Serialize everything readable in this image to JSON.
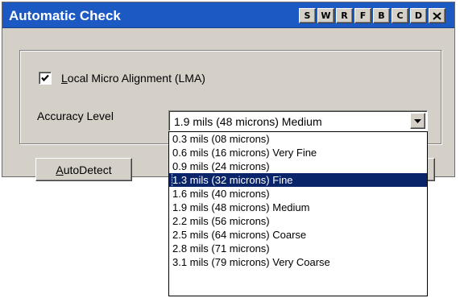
{
  "window": {
    "title": "Automatic Check",
    "title_buttons": [
      {
        "label": "S",
        "name": "title-button-s"
      },
      {
        "label": "W",
        "name": "title-button-w"
      },
      {
        "label": "R",
        "name": "title-button-r"
      },
      {
        "label": "F",
        "name": "title-button-f"
      },
      {
        "label": "B",
        "name": "title-button-b"
      },
      {
        "label": "C",
        "name": "title-button-c"
      },
      {
        "label": "D",
        "name": "title-button-d"
      }
    ],
    "close_icon": "close-icon"
  },
  "lma": {
    "checked": true,
    "label_mnemonic": "L",
    "label_rest": "ocal Micro Alignment (LMA)"
  },
  "accuracy": {
    "label": "Accuracy Level",
    "selected_value": "1.9 mils (48 microns) Medium",
    "options": [
      "0.3 mils (08 microns)",
      "0.6 mils (16 microns) Very Fine",
      "0.9 mils (24 microns)",
      "1.3 mils (32 microns) Fine",
      "1.6 mils (40 microns)",
      "1.9 mils (48 microns) Medium",
      "2.2 mils (56 microns)",
      "2.5 mils (64 microns) Coarse",
      "2.8 mils (71 microns)",
      "3.1 mils (79 microns) Very Coarse"
    ],
    "highlighted_index": 3
  },
  "autodetect": {
    "label_mnemonic": "A",
    "label_rest": "utoDetect"
  },
  "colors": {
    "title_bar": "#1d59c3",
    "window_face": "#d4d0c8",
    "highlight": "#0a246a"
  }
}
